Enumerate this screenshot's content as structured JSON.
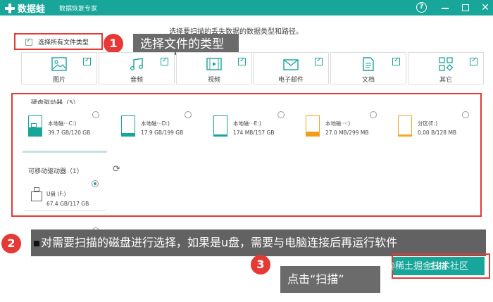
{
  "app": {
    "name": "数据蛙",
    "subtitle": "数据恢复专家",
    "close_glyph": "✕",
    "help_glyph": "?"
  },
  "instruction": "选择要扫描的丢失数据的数据类型和路径。",
  "select_all": {
    "label": "选择所有文件类型",
    "checked": true
  },
  "file_types": [
    {
      "label": "图片",
      "icon": "image-icon",
      "checked": true
    },
    {
      "label": "音频",
      "icon": "audio-icon",
      "checked": true
    },
    {
      "label": "视频",
      "icon": "video-icon",
      "checked": true
    },
    {
      "label": "电子邮件",
      "icon": "email-icon",
      "checked": true
    },
    {
      "label": "文档",
      "icon": "document-icon",
      "checked": true
    },
    {
      "label": "其它",
      "icon": "other-icon",
      "checked": true
    }
  ],
  "hard_drives": {
    "label": "硬盘驱动器（5）",
    "drives": [
      {
        "name": "本地磁···C:)",
        "size": "39.7 GB/120 GB",
        "selected": false
      },
      {
        "name": "本地磁···D:)",
        "size": "17.9 GB/199 GB",
        "selected": false
      },
      {
        "name": "本地磁···E:)",
        "size": "174 MB/157 GB",
        "selected": false
      },
      {
        "name": "本地磁···:)",
        "size": "27.0 MB/299 MB",
        "selected": false
      },
      {
        "name": "分区(E:)",
        "size": "0.00 B/128 MB",
        "selected": false
      }
    ]
  },
  "removable_drives": {
    "label": "可移动驱动器（1）",
    "drives": [
      {
        "name": "U盘 (F:)",
        "size": "67.4 GB/117 GB",
        "selected": true
      }
    ]
  },
  "callouts": [
    {
      "number": "1",
      "text": "选择文件的类型"
    },
    {
      "number": "2",
      "text": "对需要扫描的磁盘进行选择，如果是u盘，需要与电脑连接后再运行软件"
    },
    {
      "number": "3",
      "text": "点击“扫描”"
    }
  ],
  "scan_button": {
    "label": "扫描"
  },
  "watermark": "@稀土掘金技术社区",
  "colors": {
    "accent": "#18a59a",
    "highlight": "#e53935",
    "callout_bg": "#6b6b6b"
  }
}
